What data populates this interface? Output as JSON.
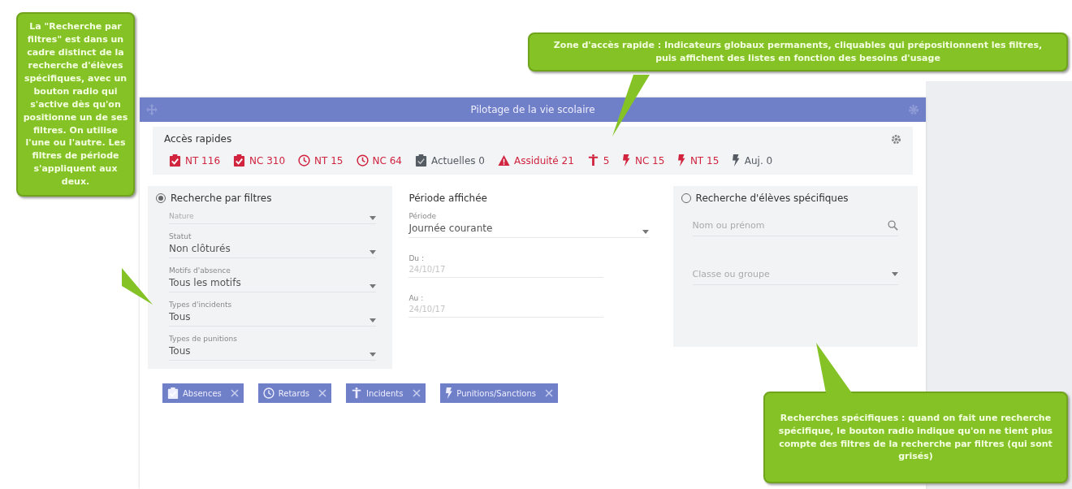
{
  "window": {
    "title": "Pilotage de la vie scolaire"
  },
  "quick_access": {
    "title": "Accès rapides",
    "items": [
      {
        "kind": "clipboard-check",
        "label": "NT 116",
        "color": "#d0243f"
      },
      {
        "kind": "clipboard-check",
        "label": "NC 310",
        "color": "#d0243f"
      },
      {
        "kind": "clock",
        "label": "NT 15",
        "color": "#d0243f"
      },
      {
        "kind": "clock",
        "label": "NC 64",
        "color": "#d0243f"
      },
      {
        "kind": "clipboard",
        "label": "Actuelles 0",
        "color": "#555b63"
      },
      {
        "kind": "warning",
        "label": "Assiduité 21",
        "color": "#d0243f"
      },
      {
        "kind": "figure",
        "label": "5",
        "color": "#d0243f"
      },
      {
        "kind": "bolt",
        "label": "NC 15",
        "color": "#d0243f"
      },
      {
        "kind": "bolt",
        "label": "NT 15",
        "color": "#d0243f"
      },
      {
        "kind": "bolt",
        "label": "Auj. 0",
        "color": "#555b63"
      }
    ]
  },
  "filter_search": {
    "label": "Recherche par filtres",
    "selected": true,
    "fields": [
      {
        "placeholder": "Nature"
      },
      {
        "label": "Statut",
        "value": "Non clôturés"
      },
      {
        "label": "Motifs d'absence",
        "value": "Tous les motifs"
      },
      {
        "label": "Types d'incidents",
        "value": "Tous"
      },
      {
        "label": "Types de punitions",
        "value": "Tous"
      }
    ]
  },
  "period": {
    "title": "Période affichée",
    "fields": [
      {
        "kind": "select",
        "label": "Période",
        "value": "Journée courante"
      },
      {
        "kind": "date",
        "label": "Du :",
        "value": "24/10/17",
        "disabled": true
      },
      {
        "kind": "date",
        "label": "Au :",
        "value": "24/10/17",
        "disabled": true
      }
    ]
  },
  "student_search": {
    "label": "Recherche d'élèves spécifiques",
    "selected": false,
    "name_placeholder": "Nom ou prénom",
    "class_placeholder": "Classe ou groupe"
  },
  "chips": [
    {
      "kind": "clipboard-check",
      "label": "Absences"
    },
    {
      "kind": "clock",
      "label": "Retards"
    },
    {
      "kind": "figure",
      "label": "Incidents"
    },
    {
      "kind": "bolt",
      "label": "Punitions/Sanctions"
    }
  ],
  "callouts": [
    {
      "text": "La \"Recherche par filtres\" est dans un cadre distinct de la recherche d'élèves spécifiques, avec un bouton radio qui s'active dès qu'on positionne un de ses filtres. On utilise l'une ou l'autre. Les filtres de période s'appliquent aux deux."
    },
    {
      "text": "Zone d'accès rapide : Indicateurs globaux permanents, cliquables qui prépositionnent les filtres, puis affichent des listes en fonction des besoins d'usage"
    },
    {
      "text": "Recherches spécifiques : quand on fait une recherche spécifique, le bouton radio indique qu'on ne tient plus compte des filtres de la recherche par filtres (qui sont grisés)"
    }
  ]
}
